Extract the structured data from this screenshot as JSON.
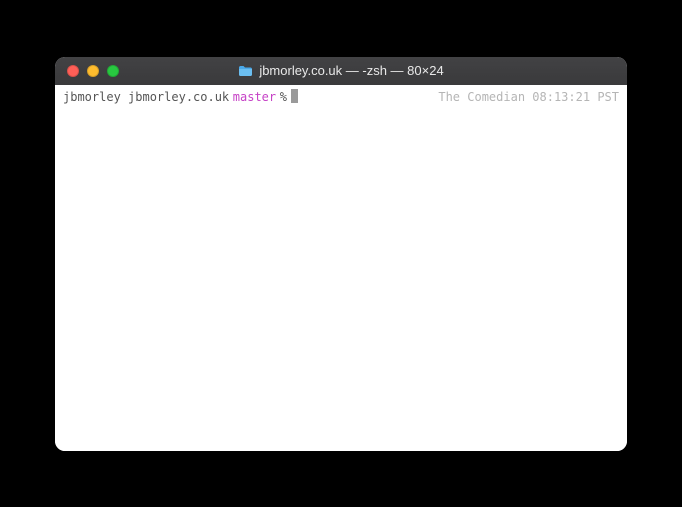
{
  "window": {
    "title": "jbmorley.co.uk — -zsh — 80×24"
  },
  "prompt": {
    "user": "jbmorley",
    "host": "jbmorley.co.uk",
    "branch": "master",
    "symbol": "%"
  },
  "right_prompt": {
    "hostname": "The Comedian",
    "time": "08:13:21",
    "tz": "PST"
  }
}
